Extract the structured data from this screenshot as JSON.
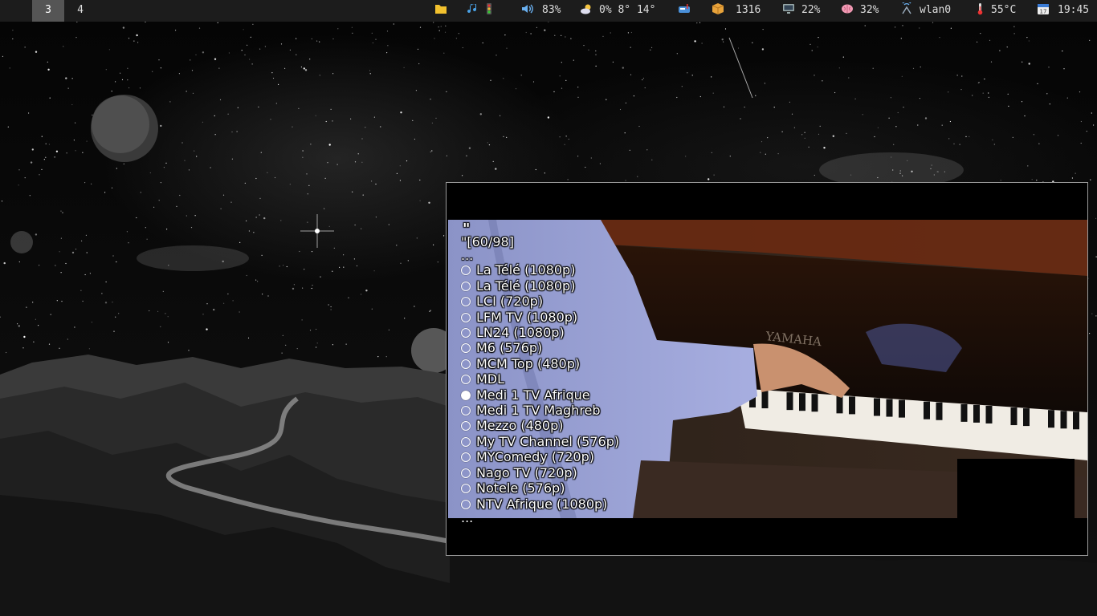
{
  "topbar": {
    "workspaces": [
      {
        "label": "3",
        "active": true
      },
      {
        "label": "4",
        "active": false
      }
    ],
    "tray": {
      "files_icon": "folder-icon",
      "music_icon": "music-note-icon",
      "traffic_icon": "traffic-light-icon",
      "volume": {
        "icon": "speaker-icon",
        "text": "83%"
      },
      "weather": {
        "icon": "cloud-sun-icon",
        "text": "0% 8° 14°"
      },
      "mail": {
        "icon": "mailbox-icon"
      },
      "packages": {
        "icon": "package-icon",
        "text": "1316"
      },
      "cpu": {
        "icon": "monitor-icon",
        "text": "22%"
      },
      "memory": {
        "icon": "brain-icon",
        "text": "32%"
      },
      "network": {
        "icon": "antenna-icon",
        "text": "wlan0"
      },
      "temperature": {
        "icon": "thermometer-icon",
        "text": "55°C"
      },
      "clock": {
        "icon": "calendar-icon",
        "text": "19:45"
      }
    }
  },
  "player": {
    "playlist": {
      "title_quote": "\"",
      "counter": "\"[60/98]",
      "ellipsis_top": "...",
      "ellipsis_bottom": "...",
      "items": [
        {
          "label": "La Télé (1080p)",
          "current": false
        },
        {
          "label": "La Télé (1080p)",
          "current": false
        },
        {
          "label": "LCI (720p)",
          "current": false
        },
        {
          "label": "LFM TV (1080p)",
          "current": false
        },
        {
          "label": "LN24 (1080p)",
          "current": false
        },
        {
          "label": "M6 (576p)",
          "current": false
        },
        {
          "label": "MCM Top (480p)",
          "current": false
        },
        {
          "label": "MDL",
          "current": false
        },
        {
          "label": "Medi 1 TV Afrique",
          "current": true
        },
        {
          "label": "Medi 1 TV Maghreb",
          "current": false
        },
        {
          "label": "Mezzo (480p)",
          "current": false
        },
        {
          "label": "My TV Channel (576p)",
          "current": false
        },
        {
          "label": "MYComedy (720p)",
          "current": false
        },
        {
          "label": "Nago TV (720p)",
          "current": false
        },
        {
          "label": "Notele (576p)",
          "current": false
        },
        {
          "label": "NTV Afrique (1080p)",
          "current": false
        }
      ]
    },
    "video": {
      "piano_brand": "YAMAHA"
    }
  },
  "colors": {
    "bar_bg": "#1c1c1c",
    "ws_active": "#555555",
    "osd_text": "#ffffff"
  }
}
